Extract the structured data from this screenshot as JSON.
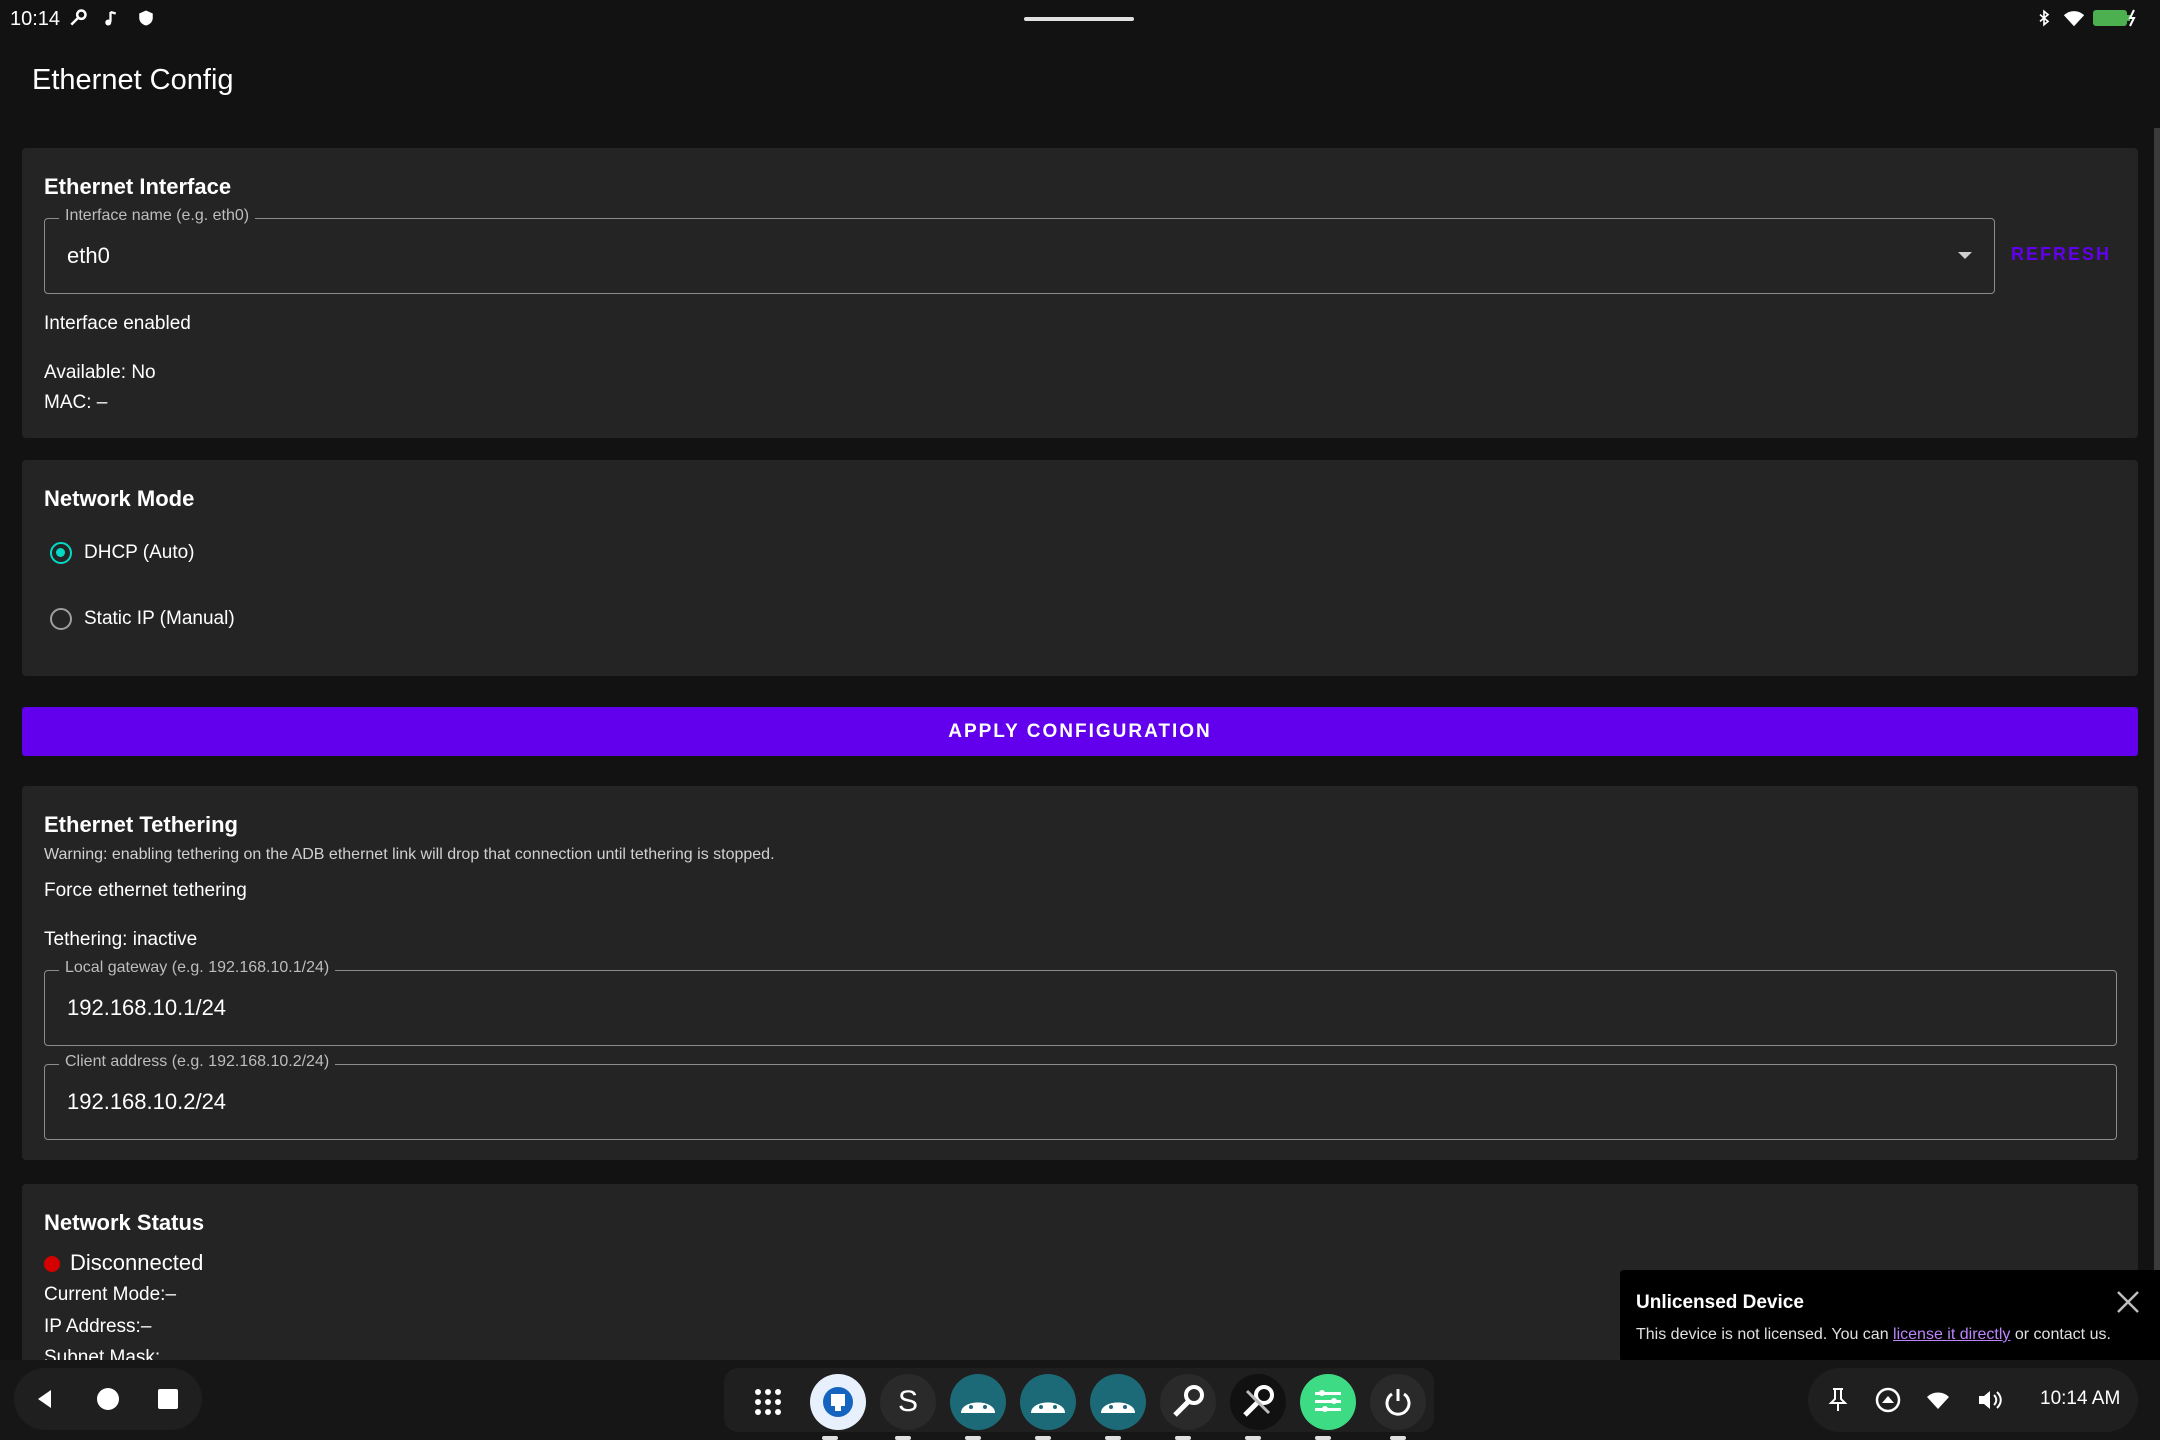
{
  "status_bar": {
    "time": "10:14",
    "left_icons": [
      "wrench-icon",
      "music-note-icon",
      "shield-icon"
    ],
    "right_icons": [
      "bluetooth-icon",
      "wifi-icon",
      "battery-charging-icon"
    ],
    "battery_color": "#4caf50"
  },
  "app_title": "Ethernet Config",
  "interface_card": {
    "title": "Ethernet Interface",
    "field_label": "Interface name (e.g. eth0)",
    "field_value": "eth0",
    "refresh_label": "REFRESH",
    "enabled_label": "Interface enabled",
    "available_text": "Available: No",
    "mac_text": "MAC: –"
  },
  "network_mode_card": {
    "title": "Network Mode",
    "options": [
      {
        "label": "DHCP (Auto)",
        "selected": true
      },
      {
        "label": "Static IP (Manual)",
        "selected": false
      }
    ]
  },
  "apply_button": "APPLY CONFIGURATION",
  "tethering_card": {
    "title": "Ethernet Tethering",
    "warning": "Warning: enabling tethering on the ADB ethernet link will drop that connection until tethering is stopped.",
    "force_label": "Force ethernet tethering",
    "status_text": "Tethering: inactive",
    "gateway_label": "Local gateway (e.g. 192.168.10.1/24)",
    "gateway_value": "192.168.10.1/24",
    "client_label": "Client address (e.g. 192.168.10.2/24)",
    "client_value": "192.168.10.2/24"
  },
  "network_status_card": {
    "title": "Network Status",
    "connection": "Disconnected",
    "connection_color": "#d50000",
    "current_mode": "Current Mode:–",
    "ip_address": "IP Address:–",
    "subnet_mask": "Subnet Mask:"
  },
  "snackbar": {
    "title": "Unlicensed Device",
    "body_prefix": "This device is not licensed. You can ",
    "link_text": "license it directly",
    "body_suffix": " or contact us."
  },
  "taskbar": {
    "nav": [
      "back-icon",
      "home-icon",
      "recents-icon"
    ],
    "apps": [
      "app-drawer-icon",
      "ethernet-app-icon",
      "s-app-icon",
      "android-app-icon",
      "android-app-icon",
      "android-app-icon",
      "wrench-app-icon",
      "tools-app-icon",
      "settings-sliders-app-icon",
      "power-icon"
    ],
    "tray_icons": [
      "pin-icon",
      "up-arrow-circle-icon",
      "wifi-icon",
      "volume-icon"
    ],
    "time": "10:14 AM"
  },
  "colors": {
    "accent": "#6200ee",
    "radio_selected": "#03dac5",
    "background": "#121212",
    "card": "#242424"
  }
}
